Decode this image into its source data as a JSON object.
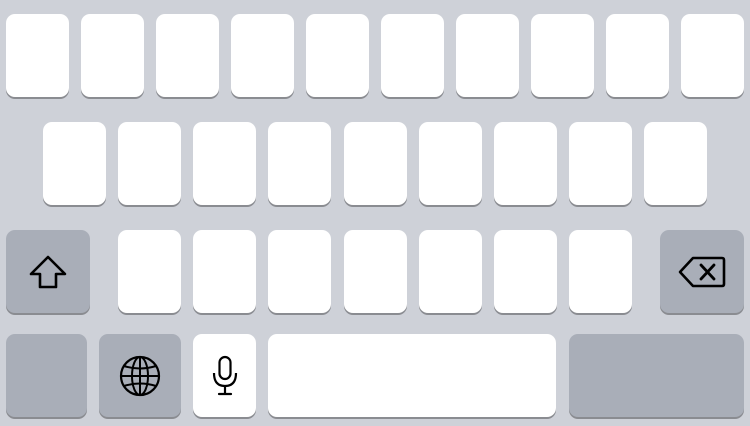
{
  "keyboard": {
    "rows": [
      {
        "keys": [
          {
            "label": ""
          },
          {
            "label": ""
          },
          {
            "label": ""
          },
          {
            "label": ""
          },
          {
            "label": ""
          },
          {
            "label": ""
          },
          {
            "label": ""
          },
          {
            "label": ""
          },
          {
            "label": ""
          },
          {
            "label": ""
          }
        ]
      },
      {
        "keys": [
          {
            "label": ""
          },
          {
            "label": ""
          },
          {
            "label": ""
          },
          {
            "label": ""
          },
          {
            "label": ""
          },
          {
            "label": ""
          },
          {
            "label": ""
          },
          {
            "label": ""
          },
          {
            "label": ""
          }
        ]
      },
      {
        "keys": [
          {
            "label": ""
          },
          {
            "label": ""
          },
          {
            "label": ""
          },
          {
            "label": ""
          },
          {
            "label": ""
          },
          {
            "label": ""
          },
          {
            "label": ""
          }
        ]
      }
    ],
    "shift_icon": "shift-arrow-icon",
    "delete_icon": "delete-backspace-icon",
    "globe_icon": "globe-icon",
    "mic_icon": "microphone-icon",
    "mode_key_label": "",
    "space_label": "",
    "return_label": ""
  },
  "colors": {
    "background": "#ced1d8",
    "letter_key": "#ffffff",
    "function_key": "#a9aeb8",
    "key_shadow": "#8a8c91"
  }
}
